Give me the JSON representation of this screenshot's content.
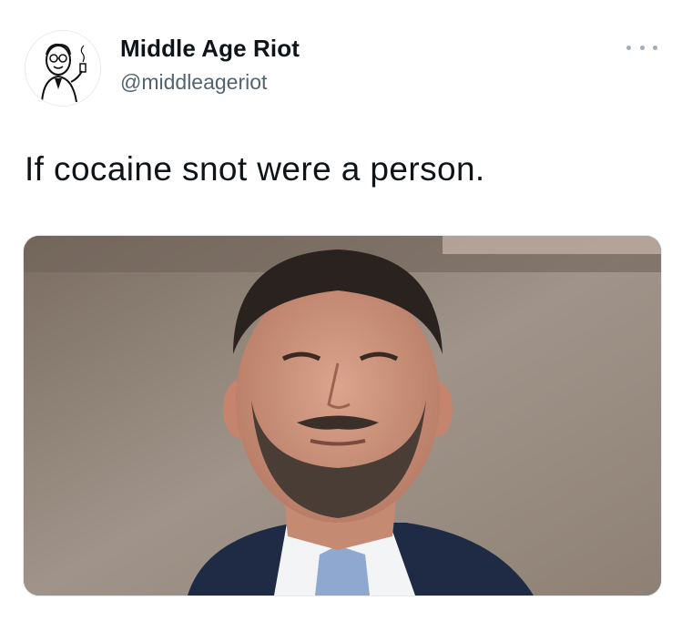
{
  "tweet": {
    "display_name": "Middle Age Riot",
    "handle": "@middleageriot",
    "text": "If cocaine snot were a person.",
    "more_icon": "more-horizontal-icon",
    "avatar_icon": "retro-man-with-pipe-illustration"
  },
  "media": {
    "description_icon": "photo",
    "colors": {
      "background": "#8a7d70",
      "suit": "#1f2a44",
      "shirt": "#f3f4f6",
      "tie": "#8fa8d0",
      "hair": "#2a221e",
      "skin": "#c98f78",
      "beard": "#4a3d36"
    }
  },
  "colors": {
    "text_primary": "#0f1419",
    "text_secondary": "#536471",
    "border": "#e7e9ea"
  }
}
